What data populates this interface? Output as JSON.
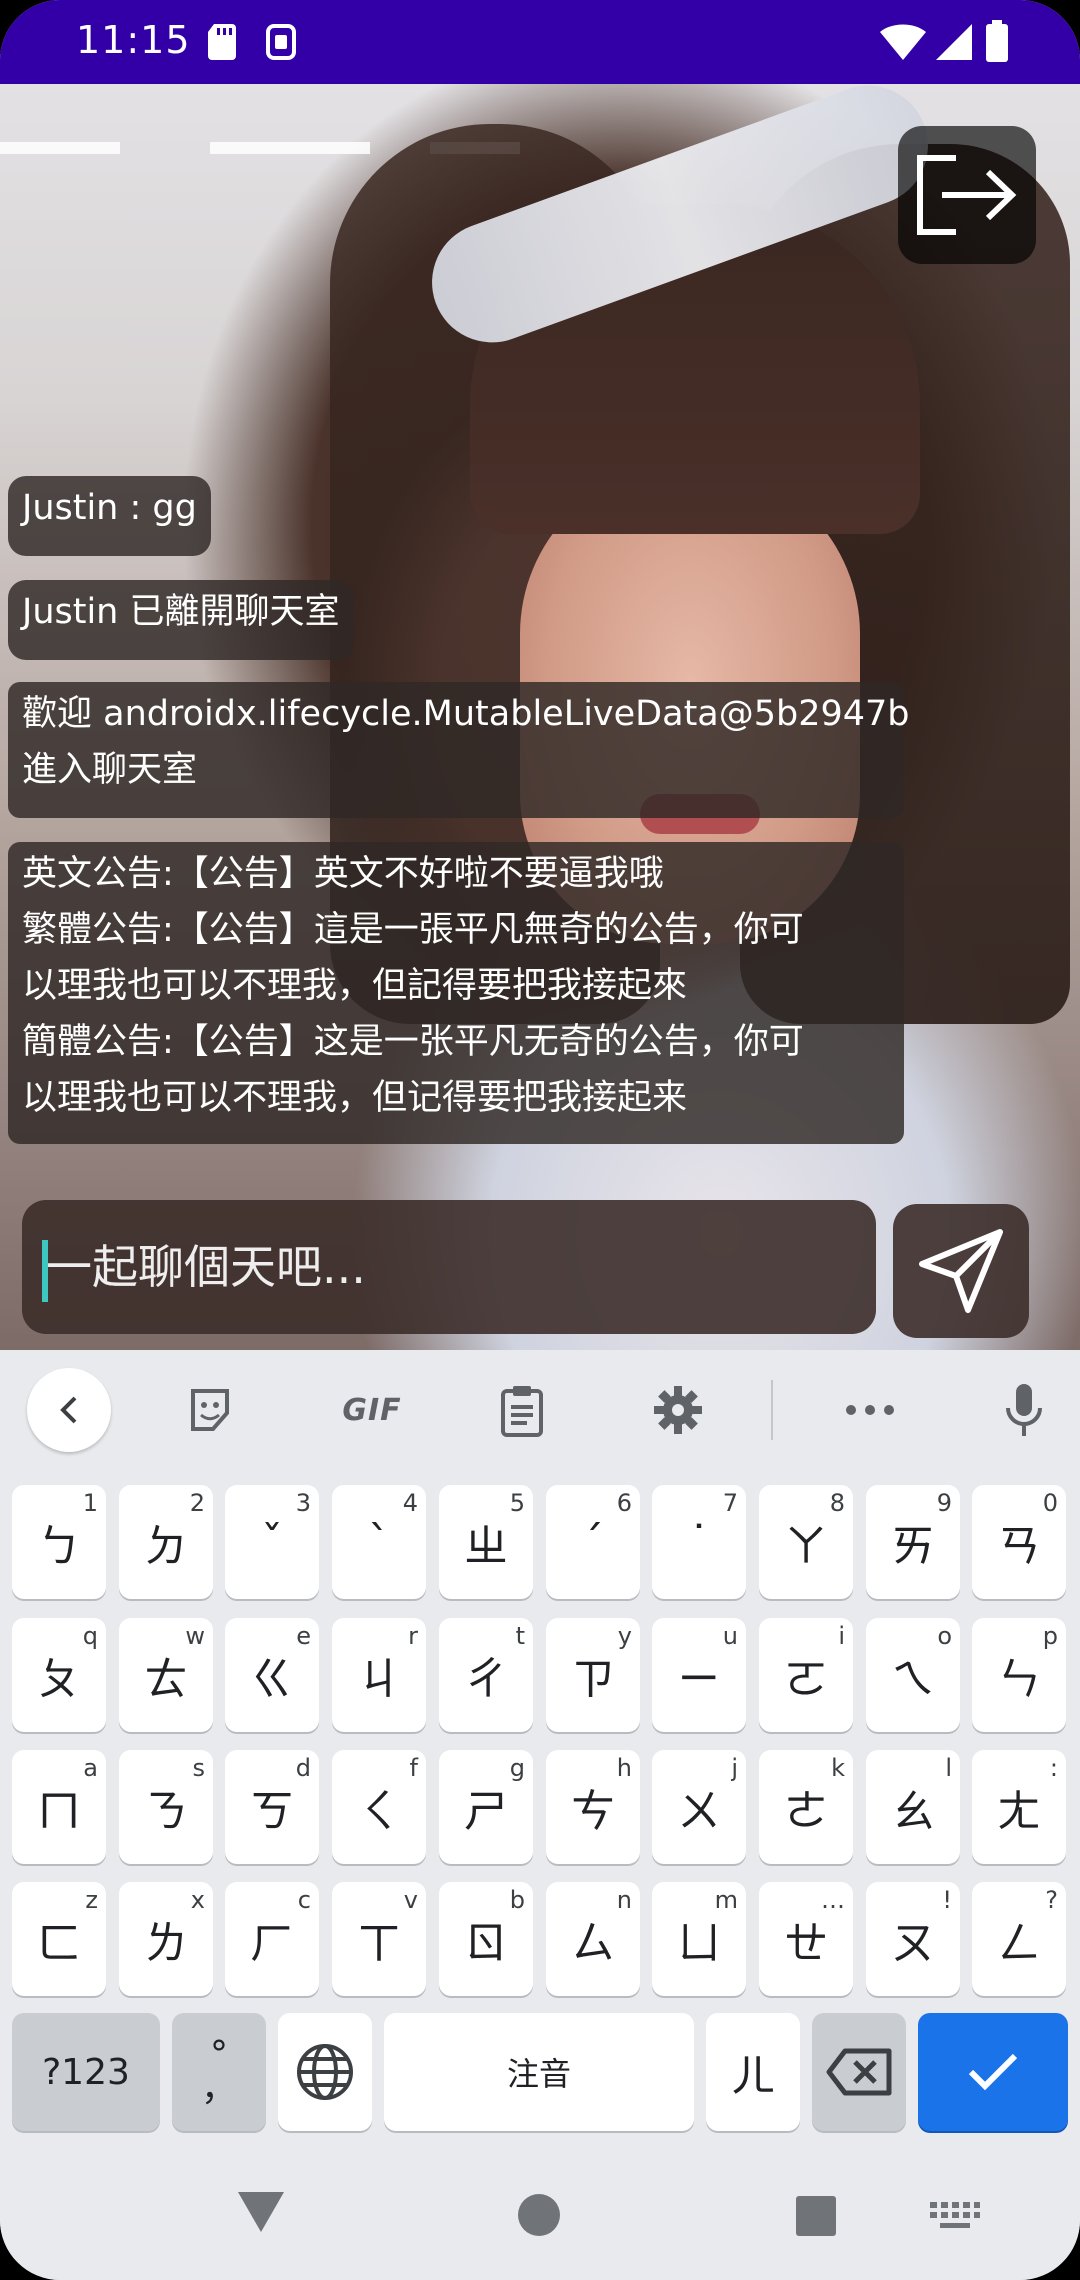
{
  "status_bar": {
    "time": "11:15",
    "icons": [
      "sd-card-icon",
      "sim-icon",
      "wifi-icon",
      "signal-icon",
      "battery-icon"
    ],
    "background": "#3200a6"
  },
  "video": {
    "exit_icon": "exit-icon"
  },
  "chat": {
    "messages": [
      {
        "lines": [
          "Justin : gg"
        ]
      },
      {
        "lines": [
          "Justin 已離開聊天室"
        ]
      },
      {
        "lines": [
          "歡迎 androidx.lifecycle.MutableLiveData@5b2947b",
          "進入聊天室"
        ]
      },
      {
        "lines": [
          "英文公告:【公告】英文不好啦不要逼我哦",
          "繁體公告:【公告】這是一張平凡無奇的公告，你可",
          "以理我也可以不理我，但記得要把我接起來",
          "簡體公告:【公告】这是一张平凡无奇的公告，你可",
          "以理我也可以不理我，但记得要把我接起来"
        ]
      }
    ],
    "input_placeholder": "一起聊個天吧...",
    "input_value": "",
    "send_icon": "send-icon"
  },
  "keyboard": {
    "toolbar": {
      "back_icon": "chevron-left-icon",
      "sticker_icon": "sticker-icon",
      "gif_label": "GIF",
      "clipboard_icon": "clipboard-icon",
      "settings_icon": "gear-icon",
      "more_icon": "more-icon",
      "mic_icon": "mic-icon"
    },
    "rows": [
      [
        [
          "ㄅ",
          "1"
        ],
        [
          "ㄉ",
          "2"
        ],
        [
          "ˇ",
          "3"
        ],
        [
          "ˋ",
          "4"
        ],
        [
          "ㄓ",
          "5"
        ],
        [
          "ˊ",
          "6"
        ],
        [
          "˙",
          "7"
        ],
        [
          "ㄚ",
          "8"
        ],
        [
          "ㄞ",
          "9"
        ],
        [
          "ㄢ",
          "0"
        ]
      ],
      [
        [
          "ㄆ",
          "q"
        ],
        [
          "ㄊ",
          "w"
        ],
        [
          "ㄍ",
          "e"
        ],
        [
          "ㄐ",
          "r"
        ],
        [
          "ㄔ",
          "t"
        ],
        [
          "ㄗ",
          "y"
        ],
        [
          "ㄧ",
          "u"
        ],
        [
          "ㄛ",
          "i"
        ],
        [
          "ㄟ",
          "o"
        ],
        [
          "ㄣ",
          "p"
        ]
      ],
      [
        [
          "ㄇ",
          "a"
        ],
        [
          "ㄋ",
          "s"
        ],
        [
          "ㄎ",
          "d"
        ],
        [
          "ㄑ",
          "f"
        ],
        [
          "ㄕ",
          "g"
        ],
        [
          "ㄘ",
          "h"
        ],
        [
          "ㄨ",
          "j"
        ],
        [
          "ㄜ",
          "k"
        ],
        [
          "ㄠ",
          "l"
        ],
        [
          "ㄤ",
          ":"
        ]
      ],
      [
        [
          "ㄈ",
          "z"
        ],
        [
          "ㄌ",
          "x"
        ],
        [
          "ㄏ",
          "c"
        ],
        [
          "ㄒ",
          "v"
        ],
        [
          "ㄖ",
          "b"
        ],
        [
          "ㄙ",
          "n"
        ],
        [
          "ㄩ",
          "m"
        ],
        [
          "ㄝ",
          "…"
        ],
        [
          "ㄡ",
          "!"
        ],
        [
          "ㄥ",
          "?"
        ]
      ]
    ],
    "bottom": {
      "symbols_label": "?123",
      "punct_top": "°",
      "punct_bottom": "，",
      "globe_icon": "globe-icon",
      "space_label": "注音",
      "er_label": "ㄦ",
      "backspace_icon": "backspace-icon",
      "enter_icon": "check-icon",
      "enter_color": "#1a73e8"
    }
  },
  "nav_bar": {
    "back_icon": "nav-back-icon",
    "home_icon": "nav-home-icon",
    "recents_icon": "nav-recents-icon",
    "keyboard_switch_icon": "keyboard-switch-icon"
  }
}
